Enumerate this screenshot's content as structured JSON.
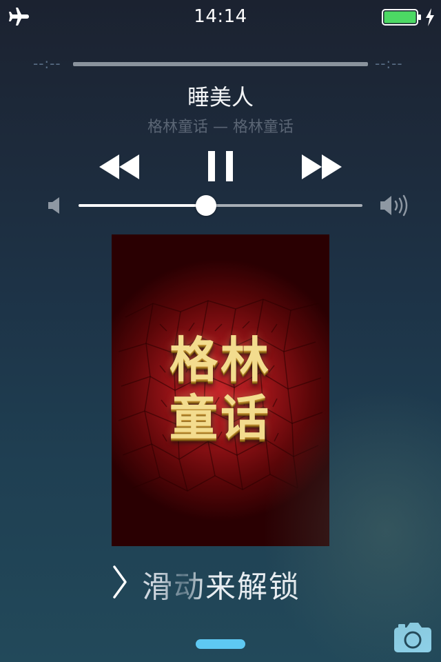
{
  "status_bar": {
    "time": "14:14",
    "airplane_icon": "airplane-icon",
    "battery_icon": "battery-icon",
    "charging_icon": "charging-bolt-icon",
    "battery_level": 1.0,
    "battery_color": "#4cd964"
  },
  "player": {
    "elapsed": "--:--",
    "remaining": "--:--",
    "progress": 0.0,
    "title": "睡美人",
    "subtitle": "格林童话 — 格林童话",
    "volume": 0.45,
    "controls": {
      "rewind_icon": "rewind-icon",
      "pause_icon": "pause-icon",
      "forward_icon": "fast-forward-icon"
    }
  },
  "album_art": {
    "line1": "格林",
    "line2": "童话"
  },
  "lock_screen": {
    "unlock_label": "滑动来解锁",
    "chevron_icon": "chevron-right-icon",
    "camera_icon": "camera-icon",
    "accent_color": "#5ec8f2"
  }
}
